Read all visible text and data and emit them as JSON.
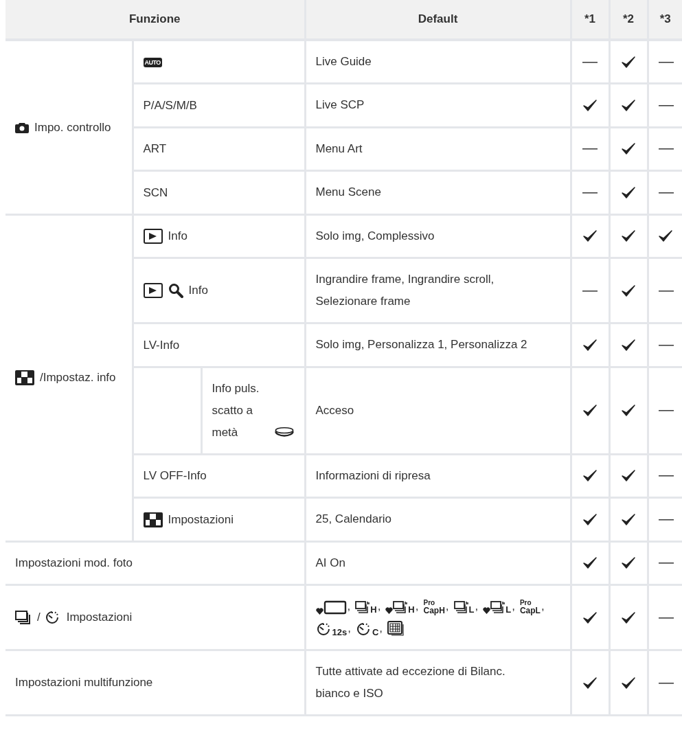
{
  "header": [
    "Funzione",
    "Default",
    "*1",
    "*2",
    "*3"
  ],
  "sections": [
    {
      "kind": "group",
      "label": [
        {
          "kind": "camera"
        },
        {
          "kind": "text",
          "text": "Impo. controllo"
        }
      ],
      "rows": [
        {
          "kind": "plain",
          "function": [
            {
              "kind": "auto",
              "text": "AUTO"
            }
          ],
          "default": "Live Guide",
          "marks": [
            {
              "checked": false
            },
            {
              "checked": true
            },
            {
              "checked": false
            }
          ]
        },
        {
          "kind": "plain",
          "function": [
            {
              "kind": "text",
              "text": "P/A/S/M/B"
            }
          ],
          "default": "Live SCP",
          "marks": [
            {
              "checked": true
            },
            {
              "checked": true
            },
            {
              "checked": false
            }
          ]
        },
        {
          "kind": "plain",
          "function": [
            {
              "kind": "text",
              "text": "ART"
            }
          ],
          "default": "Menu Art",
          "marks": [
            {
              "checked": false
            },
            {
              "checked": true
            },
            {
              "checked": false
            }
          ]
        },
        {
          "kind": "plain",
          "function": [
            {
              "kind": "text",
              "text": "SCN"
            }
          ],
          "default": "Menu Scene",
          "marks": [
            {
              "checked": false
            },
            {
              "checked": true
            },
            {
              "checked": false
            }
          ]
        }
      ]
    },
    {
      "kind": "group",
      "label": [
        {
          "kind": "grid"
        },
        {
          "kind": "text",
          "text": "/Impostaz. info"
        }
      ],
      "rows": [
        {
          "kind": "plain",
          "function": [
            {
              "kind": "play"
            },
            {
              "kind": "text",
              "text": "Info"
            }
          ],
          "default": "Solo img, Complessivo",
          "marks": [
            {
              "checked": true
            },
            {
              "checked": true
            },
            {
              "checked": true
            }
          ]
        },
        {
          "kind": "plain",
          "function": [
            {
              "kind": "play"
            },
            {
              "kind": "zoom"
            },
            {
              "kind": "text",
              "text": "Info"
            }
          ],
          "default": "Ingrandire frame, Ingrandire scroll, Selezionare frame",
          "marks": [
            {
              "checked": false
            },
            {
              "checked": true
            },
            {
              "checked": false
            }
          ]
        },
        {
          "kind": "plain",
          "function": [
            {
              "kind": "text",
              "text": "LV-Info"
            }
          ],
          "default": "Solo img, Personalizza 1, Personalizza 2",
          "marks": [
            {
              "checked": true
            },
            {
              "checked": true
            },
            {
              "checked": false
            }
          ]
        },
        {
          "kind": "nested",
          "function": [
            {
              "kind": "text",
              "text": "Info puls. scatto a metà"
            },
            {
              "kind": "shutter"
            }
          ],
          "default": "Acceso",
          "marks": [
            {
              "checked": true
            },
            {
              "checked": true
            },
            {
              "checked": false
            }
          ]
        },
        {
          "kind": "plain",
          "function": [
            {
              "kind": "text",
              "text": "LV OFF-Info"
            }
          ],
          "default": "Informazioni di ripresa",
          "marks": [
            {
              "checked": true
            },
            {
              "checked": true
            },
            {
              "checked": false
            }
          ]
        },
        {
          "kind": "plain",
          "function": [
            {
              "kind": "grid"
            },
            {
              "kind": "text",
              "text": "Impostazioni"
            }
          ],
          "default": "25, Calendario",
          "marks": [
            {
              "checked": true
            },
            {
              "checked": true
            },
            {
              "checked": false
            }
          ]
        }
      ]
    },
    {
      "kind": "single",
      "function": [
        {
          "kind": "text",
          "text": "Impostazioni mod. foto"
        }
      ],
      "default": "AI On",
      "marks": [
        {
          "checked": true
        },
        {
          "checked": true
        },
        {
          "checked": false
        }
      ]
    },
    {
      "kind": "single",
      "function": [
        {
          "kind": "burst"
        },
        {
          "kind": "text",
          "text": "/"
        },
        {
          "kind": "timer"
        },
        {
          "kind": "text",
          "text": "Impostazioni"
        }
      ],
      "modes": [
        {
          "kind": "frame",
          "heart": true,
          "sep": ","
        },
        {
          "kind": "burst",
          "heart": false,
          "letter": "H",
          "sep": ","
        },
        {
          "kind": "burst",
          "heart": true,
          "letter": "H",
          "sep": ","
        },
        {
          "kind": "procap",
          "heart": false,
          "top": "Pro",
          "letter": "CapH",
          "sep": ","
        },
        {
          "kind": "burst",
          "heart": false,
          "letter": "L",
          "sep": ","
        },
        {
          "kind": "burst",
          "heart": true,
          "letter": "L",
          "sep": ","
        },
        {
          "kind": "procap",
          "heart": false,
          "top": "Pro",
          "letter": "CapL",
          "sep": ","
        },
        {
          "kind": "timer",
          "heart": false,
          "letter": "12s",
          "sep": ","
        },
        {
          "kind": "timer",
          "heart": false,
          "letter": "C",
          "sep": ","
        },
        {
          "kind": "interval",
          "heart": false
        }
      ],
      "marks": [
        {
          "checked": true
        },
        {
          "checked": true
        },
        {
          "checked": false
        }
      ]
    },
    {
      "kind": "single",
      "function": [
        {
          "kind": "text",
          "text": "Impostazioni multifunzione"
        }
      ],
      "default": "Tutte attivate ad eccezione di Bilanc. bianco e ISO",
      "marks": [
        {
          "checked": true
        },
        {
          "checked": true
        },
        {
          "checked": false
        }
      ]
    }
  ]
}
